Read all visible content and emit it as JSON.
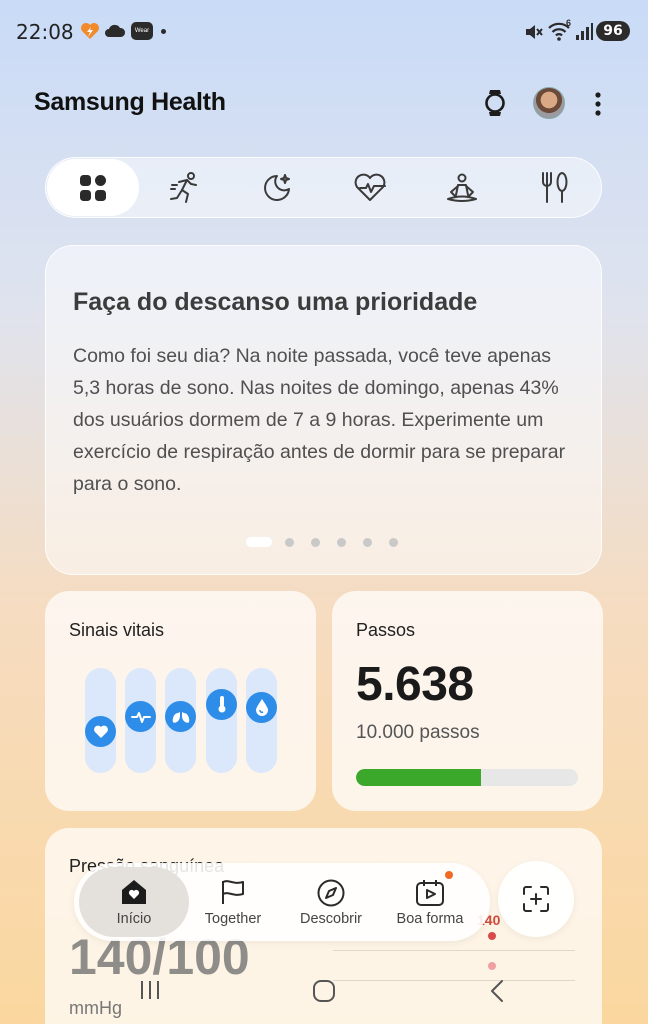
{
  "status_bar": {
    "time": "22:08",
    "battery": "96",
    "wear_label": "Wear",
    "signal_badge": "6",
    "icons": [
      "heart-flash-icon",
      "cloud-icon",
      "wear-icon",
      "notification-dot-icon",
      "mute-icon",
      "wifi-icon",
      "signal-icon",
      "battery-icon"
    ]
  },
  "header": {
    "title": "Samsung Health",
    "icons": [
      "watch-icon",
      "avatar",
      "more-icon"
    ]
  },
  "category_tabs": [
    {
      "icon": "dashboard-icon",
      "active": true
    },
    {
      "icon": "running-icon",
      "active": false
    },
    {
      "icon": "sleep-moon-icon",
      "active": false
    },
    {
      "icon": "heart-rate-icon",
      "active": false
    },
    {
      "icon": "meditation-icon",
      "active": false
    },
    {
      "icon": "food-icon",
      "active": false
    }
  ],
  "tip_card": {
    "title": "Faça do descanso uma prioridade",
    "body": "Como foi seu dia? Na noite passada, você teve apenas 5,3 horas de sono. Nas noites de domingo, apenas 43% dos usuários dormem de 7 a 9 horas. Experimente um exercício de respiração antes de dormir para se preparar para o sono.",
    "page_count": 6,
    "active_page": 1
  },
  "vitals": {
    "title": "Sinais vitais",
    "items": [
      {
        "icon": "heart-icon",
        "level": 0.35
      },
      {
        "icon": "heartbeat-icon",
        "level": 0.55
      },
      {
        "icon": "lungs-icon",
        "level": 0.55
      },
      {
        "icon": "thermometer-icon",
        "level": 0.72
      },
      {
        "icon": "drop-icon",
        "level": 0.68
      }
    ],
    "accent": "#2e8de8"
  },
  "steps": {
    "title": "Passos",
    "value": "5.638",
    "goal": "10.000 passos",
    "progress": 0.5638,
    "bar_color": "#3ba82b"
  },
  "blood_pressure": {
    "title": "Pressão sanguínea",
    "value": "140/100",
    "unit": "mmHg",
    "chart_mark": "140"
  },
  "bottom_nav": {
    "items": [
      {
        "label": "Início",
        "icon": "home-icon",
        "active": true
      },
      {
        "label": "Together",
        "icon": "flag-icon",
        "active": false
      },
      {
        "label": "Descobrir",
        "icon": "compass-icon",
        "active": false
      },
      {
        "label": "Boa forma",
        "icon": "calendar-play-icon",
        "active": false,
        "badge": true
      }
    ],
    "fab_icon": "scan-plus-icon"
  },
  "system_nav": [
    "recents-icon",
    "home-button-icon",
    "back-icon"
  ]
}
